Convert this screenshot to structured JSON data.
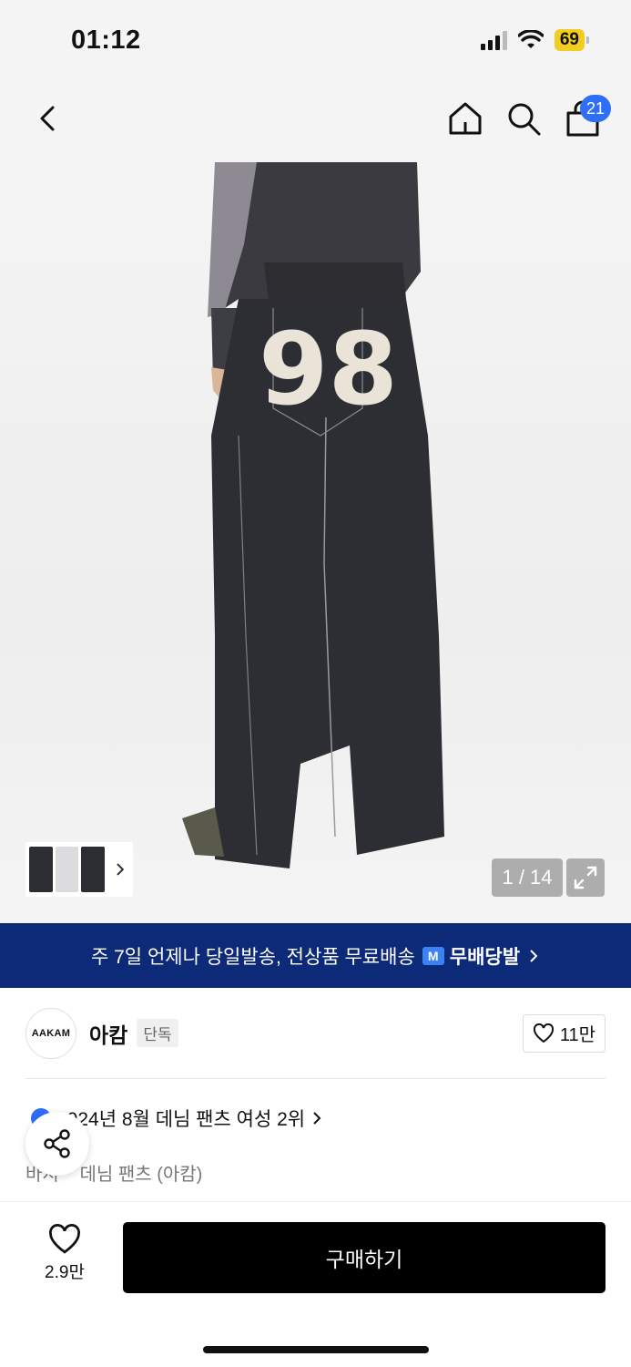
{
  "status": {
    "time": "01:12",
    "battery": "69"
  },
  "nav": {
    "cart_count": "21"
  },
  "gallery": {
    "counter": "1 / 14"
  },
  "promo": {
    "text": "주 7일 언제나 당일발송, 전상품 무료배송",
    "badge": "무배당발",
    "badge_icon": "M"
  },
  "brand": {
    "logo_text": "AAKAM",
    "name": "아캄",
    "tag": "단독",
    "follow_count": "11만"
  },
  "ranking": {
    "text": "2024년 8월 데님 팬츠 여성 2위"
  },
  "breadcrumb": {
    "items": [
      "바지",
      "데님 팬츠 (아캄)"
    ]
  },
  "bottom": {
    "like_count": "2.9만",
    "buy_label": "구매하기"
  },
  "colors": {
    "promo_bg": "#0d2a78",
    "accent": "#2f6ef6",
    "buy_bg": "#000000"
  }
}
